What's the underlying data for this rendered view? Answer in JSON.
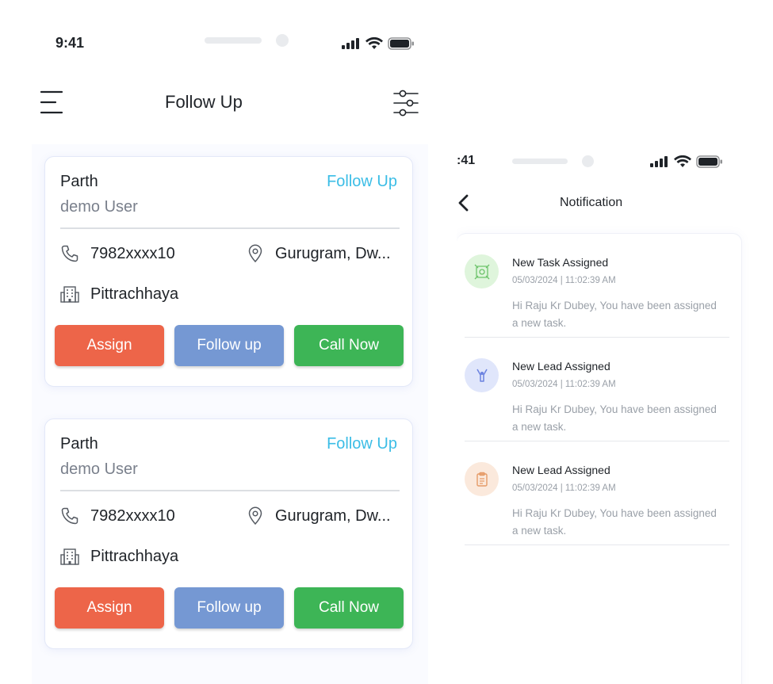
{
  "follow_up_screen": {
    "status_bar": {
      "time": "9:41"
    },
    "header": {
      "title": "Follow Up",
      "menu_icon": "hamburger-icon",
      "filter_icon": "sliders-icon"
    },
    "leads": [
      {
        "name": "Parth",
        "role": "demo User",
        "status": "Follow Up",
        "phone": "7982xxxx10",
        "location": "Gurugram, Dw...",
        "organization": "Pittrachhaya",
        "buttons": {
          "assign": "Assign",
          "follow_up": "Follow up",
          "call_now": "Call Now"
        }
      },
      {
        "name": "Parth",
        "role": "demo User",
        "status": "Follow Up",
        "phone": "7982xxxx10",
        "location": "Gurugram, Dw...",
        "organization": "Pittrachhaya",
        "buttons": {
          "assign": "Assign",
          "follow_up": "Follow up",
          "call_now": "Call Now"
        }
      }
    ],
    "colors": {
      "assign": "#ed6549",
      "follow_up": "#7598d3",
      "call_now": "#3db556",
      "status_text": "#3bbde6"
    }
  },
  "notification_screen": {
    "status_bar": {
      "time": ":41"
    },
    "header": {
      "title": "Notification",
      "back_icon": "chevron-left-icon"
    },
    "notifications": [
      {
        "title": "New Task Assigned",
        "time": "05/03/2024 | 11:02:39 AM",
        "message": "Hi Raju Kr Dubey, You have been assigned a new task.",
        "icon": "task-icon",
        "icon_color": "#dff5dc"
      },
      {
        "title": "New Lead Assigned",
        "time": "05/03/2024 | 11:02:39 AM",
        "message": "Hi Raju Kr Dubey, You have been assigned a new task.",
        "icon": "lead-funnel-icon",
        "icon_color": "#e0e6fb"
      },
      {
        "title": "New Lead Assigned",
        "time": "05/03/2024 | 11:02:39 AM",
        "message": "Hi Raju Kr Dubey, You have been assigned a new task.",
        "icon": "clipboard-icon",
        "icon_color": "#fbe9dc"
      }
    ]
  }
}
